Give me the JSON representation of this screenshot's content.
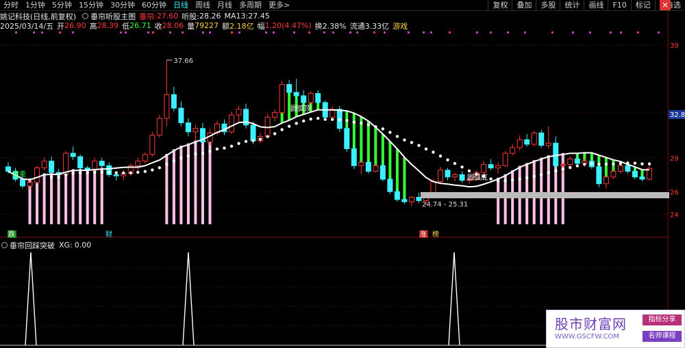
{
  "toolbar": {
    "timeframes": [
      "分时",
      "1分钟",
      "5分钟",
      "15分钟",
      "30分钟",
      "60分钟",
      "日线",
      "周线",
      "月线",
      "多周期",
      "更多>"
    ],
    "active": "日线",
    "right_buttons": [
      "复权",
      "叠加",
      "多股",
      "统计",
      "画线",
      "F10",
      "标记",
      "+自选"
    ]
  },
  "header": {
    "stock": "姚记科技(日线,前复权)",
    "indicator": "垂帘听股主图",
    "k1": "垂帘:",
    "v1": "27.60",
    "k2": "听股:",
    "v2": "28.26",
    "k3": "MA13:",
    "v3": "27.45"
  },
  "quote": {
    "date": "2025/03/14/五",
    "open_k": "开",
    "open": "26.90",
    "high_k": "高",
    "high": "28.39",
    "low_k": "低",
    "low": "26.71",
    "close_k": "收",
    "close": "28.06",
    "vol_k": "量",
    "vol": "79227",
    "amt_k": "额",
    "amt": "2.18亿",
    "chg_k": "幅",
    "chg": "1.20(4.47%)",
    "turnover": "换2.38%",
    "float": "流通3.33亿",
    "sector": "游戏"
  },
  "chart_labels": {
    "max_price": "37.66",
    "range": "24.74 - 25.31",
    "huoyuandi1": "圆弧顶",
    "huoyuandi2": "圆弧底",
    "jian": "逢卖",
    "die": "跌",
    "cai": "财",
    "zhang": "涨",
    "bang": "榜",
    "right_price": "32.8"
  },
  "yaxis": [
    "39",
    "33",
    "29",
    "26",
    "24"
  ],
  "indicator": {
    "name": "垂帘回踩突破",
    "xg_label": "XG:",
    "xg_value": "0.00"
  },
  "ad": {
    "title": "股市财富网",
    "url": "WWW.GSCFW.COM",
    "tag1": "指标分享",
    "tag2": "名师课程"
  },
  "colors": {
    "up": "#ff3a3a",
    "down": "#3af0ff",
    "green_fill": "#33ff33",
    "pink_fill": "#ffc0e8"
  },
  "chart_data": {
    "type": "candlestick",
    "candles": [
      [
        28.2,
        28.6,
        27.6,
        27.8
      ],
      [
        27.8,
        28.1,
        26.9,
        27.1
      ],
      [
        27.1,
        27.4,
        26.3,
        26.5
      ],
      [
        26.5,
        27.0,
        26.2,
        26.8
      ],
      [
        26.8,
        28.3,
        26.7,
        28.1
      ],
      [
        28.1,
        29.0,
        27.9,
        28.7
      ],
      [
        28.7,
        29.1,
        27.5,
        27.7
      ],
      [
        27.7,
        28.0,
        27.2,
        27.5
      ],
      [
        27.5,
        29.6,
        27.4,
        29.4
      ],
      [
        29.4,
        30.0,
        28.8,
        29.1
      ],
      [
        29.1,
        29.3,
        27.9,
        28.1
      ],
      [
        28.1,
        28.3,
        27.6,
        27.9
      ],
      [
        27.9,
        29.0,
        27.7,
        28.7
      ],
      [
        28.7,
        29.0,
        28.0,
        28.3
      ],
      [
        28.3,
        28.6,
        27.3,
        27.5
      ],
      [
        27.5,
        27.8,
        27.0,
        27.4
      ],
      [
        27.4,
        27.9,
        27.0,
        27.6
      ],
      [
        27.6,
        28.5,
        27.4,
        28.3
      ],
      [
        28.3,
        29.0,
        27.9,
        28.7
      ],
      [
        28.7,
        29.5,
        28.5,
        29.3
      ],
      [
        29.3,
        31.3,
        29.1,
        31.0
      ],
      [
        31.0,
        32.8,
        30.8,
        32.5
      ],
      [
        32.5,
        37.66,
        31.8,
        34.6
      ],
      [
        34.6,
        35.3,
        33.1,
        33.4
      ],
      [
        33.4,
        34.0,
        31.8,
        32.1
      ],
      [
        32.1,
        32.5,
        30.9,
        31.3
      ],
      [
        31.3,
        31.9,
        30.5,
        31.6
      ],
      [
        31.6,
        32.1,
        30.2,
        30.4
      ],
      [
        30.4,
        31.6,
        30.1,
        31.2
      ],
      [
        31.2,
        32.3,
        31.0,
        32.0
      ],
      [
        32.0,
        32.4,
        31.0,
        31.3
      ],
      [
        31.3,
        33.1,
        31.1,
        32.8
      ],
      [
        32.8,
        33.6,
        32.2,
        33.3
      ],
      [
        33.3,
        33.8,
        31.6,
        31.9
      ],
      [
        31.9,
        32.2,
        30.2,
        30.5
      ],
      [
        30.5,
        31.2,
        30.3,
        30.9
      ],
      [
        30.9,
        32.9,
        30.8,
        32.6
      ],
      [
        32.6,
        33.3,
        32.2,
        33.0
      ],
      [
        33.0,
        35.8,
        32.9,
        35.5
      ],
      [
        35.5,
        35.9,
        34.5,
        34.8
      ],
      [
        34.8,
        36.0,
        34.0,
        34.5
      ],
      [
        34.5,
        35.0,
        33.5,
        33.9
      ],
      [
        33.9,
        34.9,
        33.7,
        34.7
      ],
      [
        34.7,
        35.0,
        33.7,
        33.9
      ],
      [
        33.9,
        34.1,
        32.3,
        32.6
      ],
      [
        32.6,
        33.6,
        32.4,
        33.3
      ],
      [
        33.3,
        33.6,
        31.3,
        31.6
      ],
      [
        31.6,
        31.9,
        29.5,
        29.8
      ],
      [
        29.8,
        30.2,
        28.0,
        28.3
      ],
      [
        28.3,
        28.8,
        27.5,
        28.6
      ],
      [
        28.6,
        28.8,
        27.6,
        27.8
      ],
      [
        27.8,
        28.5,
        27.7,
        28.3
      ],
      [
        28.3,
        28.7,
        26.9,
        27.1
      ],
      [
        27.1,
        27.3,
        25.8,
        26.0
      ],
      [
        26.0,
        26.3,
        25.1,
        25.3
      ],
      [
        25.3,
        25.8,
        24.9,
        25.1
      ],
      [
        25.1,
        25.6,
        24.74,
        25.5
      ],
      [
        25.5,
        25.9,
        25.0,
        25.2
      ],
      [
        25.2,
        25.8,
        24.8,
        25.6
      ],
      [
        25.6,
        27.1,
        25.5,
        26.9
      ],
      [
        26.9,
        28.2,
        26.7,
        27.9
      ],
      [
        27.9,
        28.1,
        27.0,
        27.3
      ],
      [
        27.3,
        27.7,
        26.9,
        27.5
      ],
      [
        27.5,
        27.8,
        26.8,
        27.0
      ],
      [
        27.0,
        27.3,
        26.7,
        27.1
      ],
      [
        27.1,
        27.9,
        27.0,
        27.7
      ],
      [
        27.7,
        28.7,
        27.5,
        28.4
      ],
      [
        28.4,
        28.9,
        27.9,
        28.1
      ],
      [
        28.1,
        28.6,
        27.6,
        28.3
      ],
      [
        28.3,
        29.6,
        28.2,
        29.4
      ],
      [
        29.4,
        30.2,
        29.2,
        29.9
      ],
      [
        29.9,
        31.0,
        29.7,
        30.6
      ],
      [
        30.6,
        31.1,
        30.0,
        30.2
      ],
      [
        30.2,
        31.4,
        30.0,
        31.2
      ],
      [
        31.2,
        31.5,
        29.9,
        30.1
      ],
      [
        30.1,
        31.8,
        29.8,
        30.3
      ],
      [
        30.3,
        30.9,
        28.0,
        28.3
      ],
      [
        28.3,
        28.6,
        27.7,
        28.4
      ],
      [
        28.4,
        29.1,
        28.0,
        28.9
      ],
      [
        28.9,
        29.4,
        28.3,
        28.5
      ],
      [
        28.5,
        29.0,
        28.2,
        28.7
      ],
      [
        28.7,
        29.1,
        28.0,
        28.2
      ],
      [
        28.2,
        28.5,
        26.4,
        26.7
      ],
      [
        26.7,
        27.5,
        26.3,
        27.3
      ],
      [
        27.3,
        28.0,
        27.1,
        27.8
      ],
      [
        27.8,
        28.5,
        27.6,
        28.3
      ],
      [
        28.3,
        28.7,
        27.6,
        27.8
      ],
      [
        27.8,
        28.2,
        27.1,
        27.3
      ],
      [
        27.3,
        27.6,
        26.9,
        27.1
      ],
      [
        27.1,
        28.4,
        27.0,
        28.06
      ]
    ]
  }
}
